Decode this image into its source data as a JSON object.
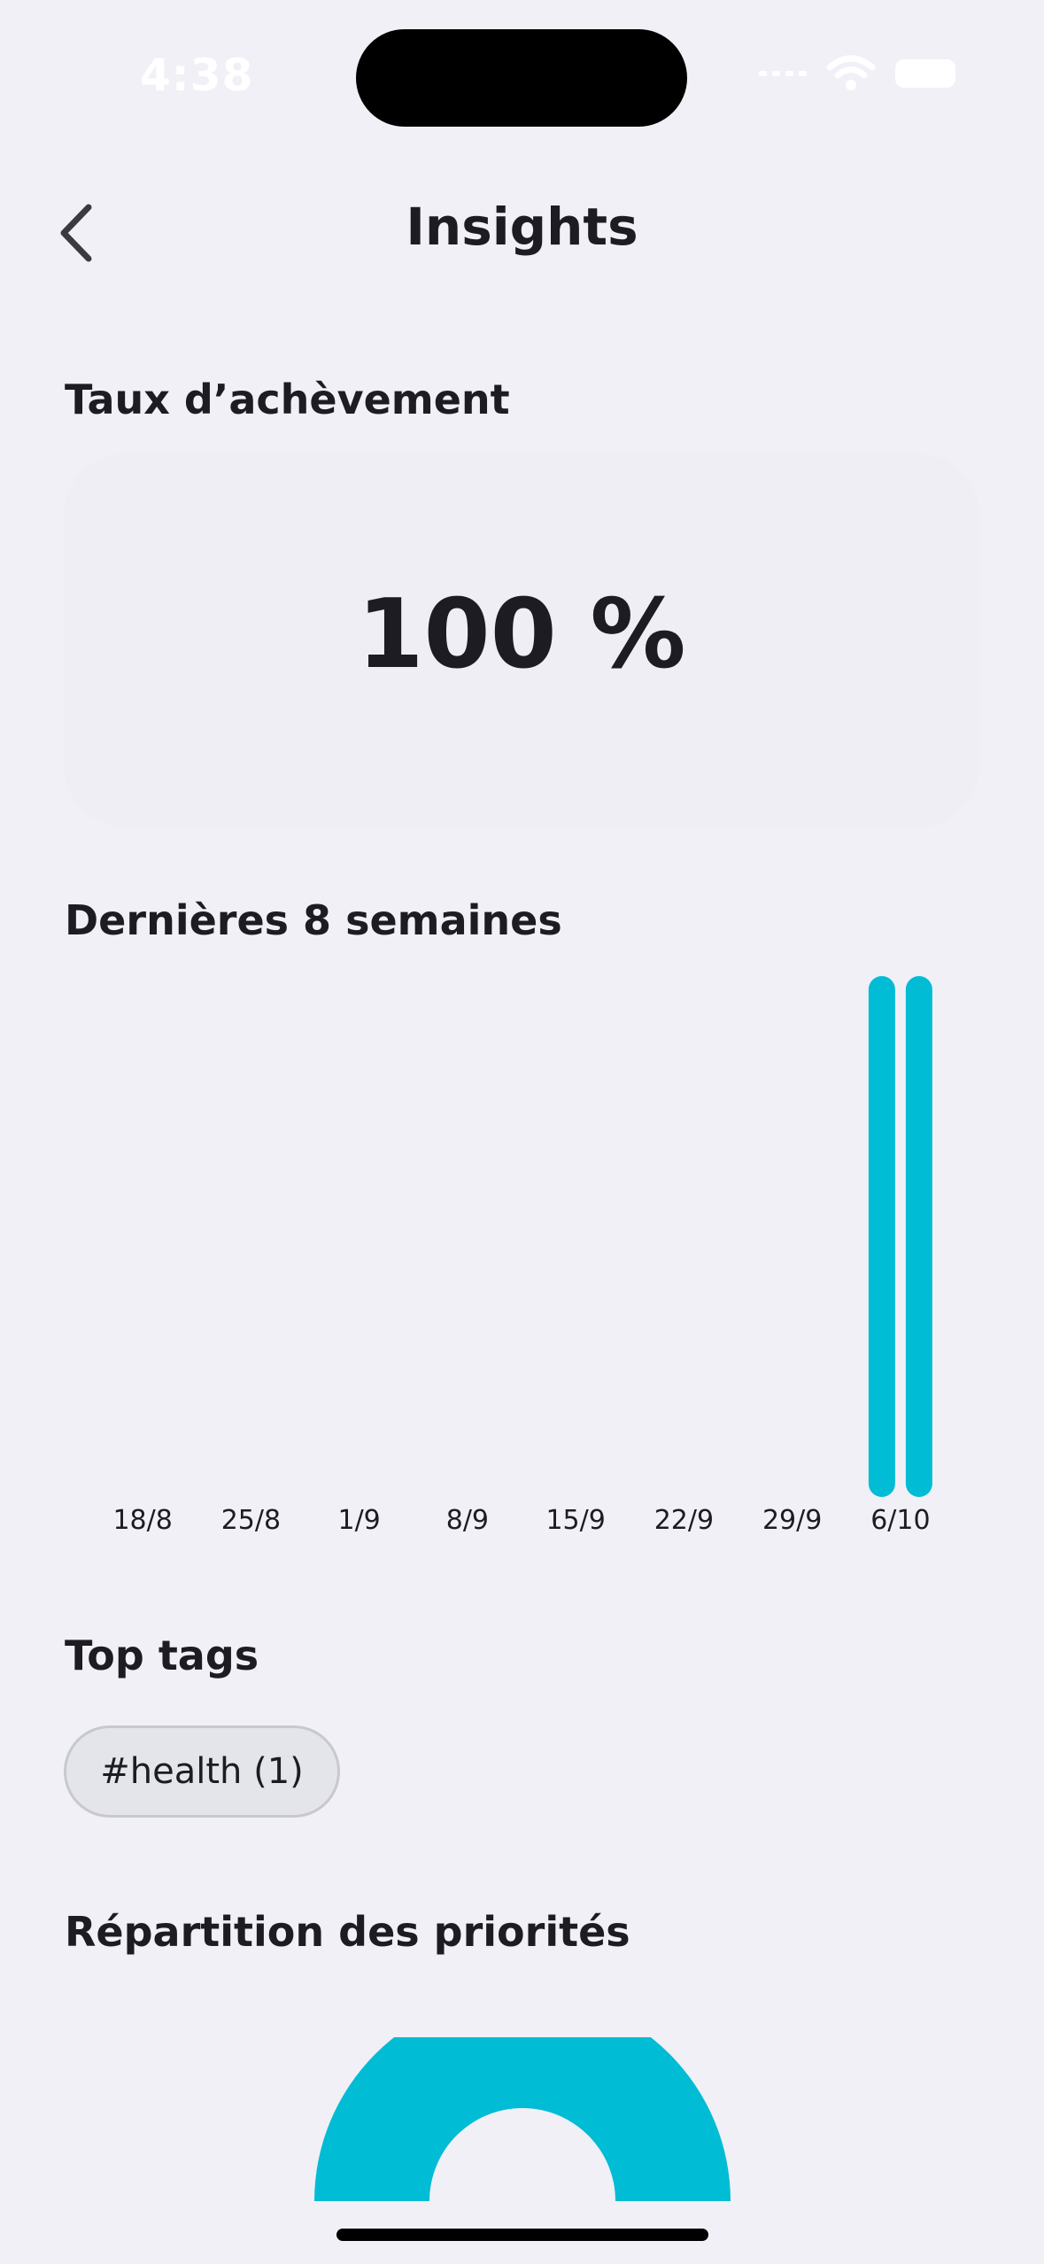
{
  "status_bar": {
    "time": "4:38"
  },
  "nav": {
    "title": "Insights"
  },
  "completion": {
    "title": "Taux d’achèvement",
    "value": "100 %"
  },
  "weekly": {
    "title": "Dernières 8 semaines"
  },
  "chart_data": {
    "type": "bar",
    "categories": [
      "18/8",
      "25/8",
      "1/9",
      "8/9",
      "15/9",
      "22/9",
      "29/9",
      "6/10"
    ],
    "series": [
      {
        "values": [
          0,
          0,
          0,
          0,
          0,
          0,
          0,
          1
        ]
      },
      {
        "values": [
          0,
          0,
          0,
          0,
          0,
          0,
          0,
          1
        ]
      }
    ],
    "ylim": [
      0,
      1
    ],
    "grid": false,
    "colors": [
      "#00bcd4",
      "#00bcd4"
    ]
  },
  "tags": {
    "title": "Top tags",
    "items": [
      {
        "label": "#health (1)"
      }
    ]
  },
  "priorities": {
    "title": "Répartition des priorités",
    "color": "#00bcd4"
  }
}
